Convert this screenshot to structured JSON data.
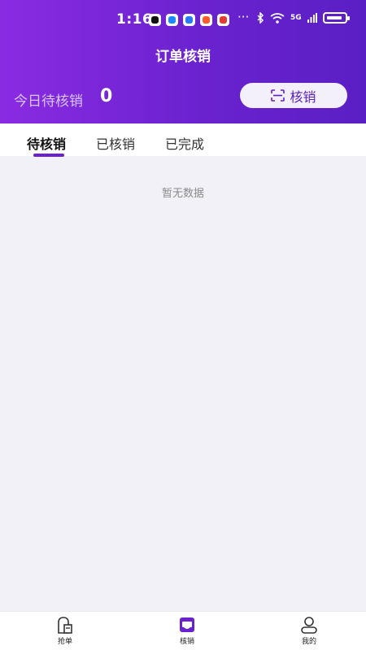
{
  "status_bar": {
    "time": "1:16",
    "overflow": "···",
    "signal_text": "5G",
    "apps": [
      {
        "icon": "tiktok-icon",
        "color": "#111111"
      },
      {
        "icon": "message-app-icon",
        "color": "#1e88ff"
      },
      {
        "icon": "chat-app-icon",
        "color": "#2979ff"
      },
      {
        "icon": "game-app-icon",
        "color": "#ff5b2e"
      },
      {
        "icon": "mascot-app-icon",
        "color": "#e53935"
      }
    ]
  },
  "header": {
    "title": "订单核销",
    "today_label": "今日待核销",
    "today_count": "0",
    "verify_button": "核销"
  },
  "tabs": [
    {
      "label": "待核销",
      "active": true
    },
    {
      "label": "已核销",
      "active": false
    },
    {
      "label": "已完成",
      "active": false
    }
  ],
  "empty_text": "暂无数据",
  "bottom_nav": [
    {
      "label": "抢单",
      "icon": "store-icon"
    },
    {
      "label": "核销",
      "icon": "verify-icon",
      "active": true
    },
    {
      "label": "我的",
      "icon": "user-icon"
    }
  ],
  "colors": {
    "accent": "#6a22cf",
    "gradient_start": "#8a2be2",
    "gradient_end": "#5a1fc4",
    "background": "#f2f1f7"
  }
}
